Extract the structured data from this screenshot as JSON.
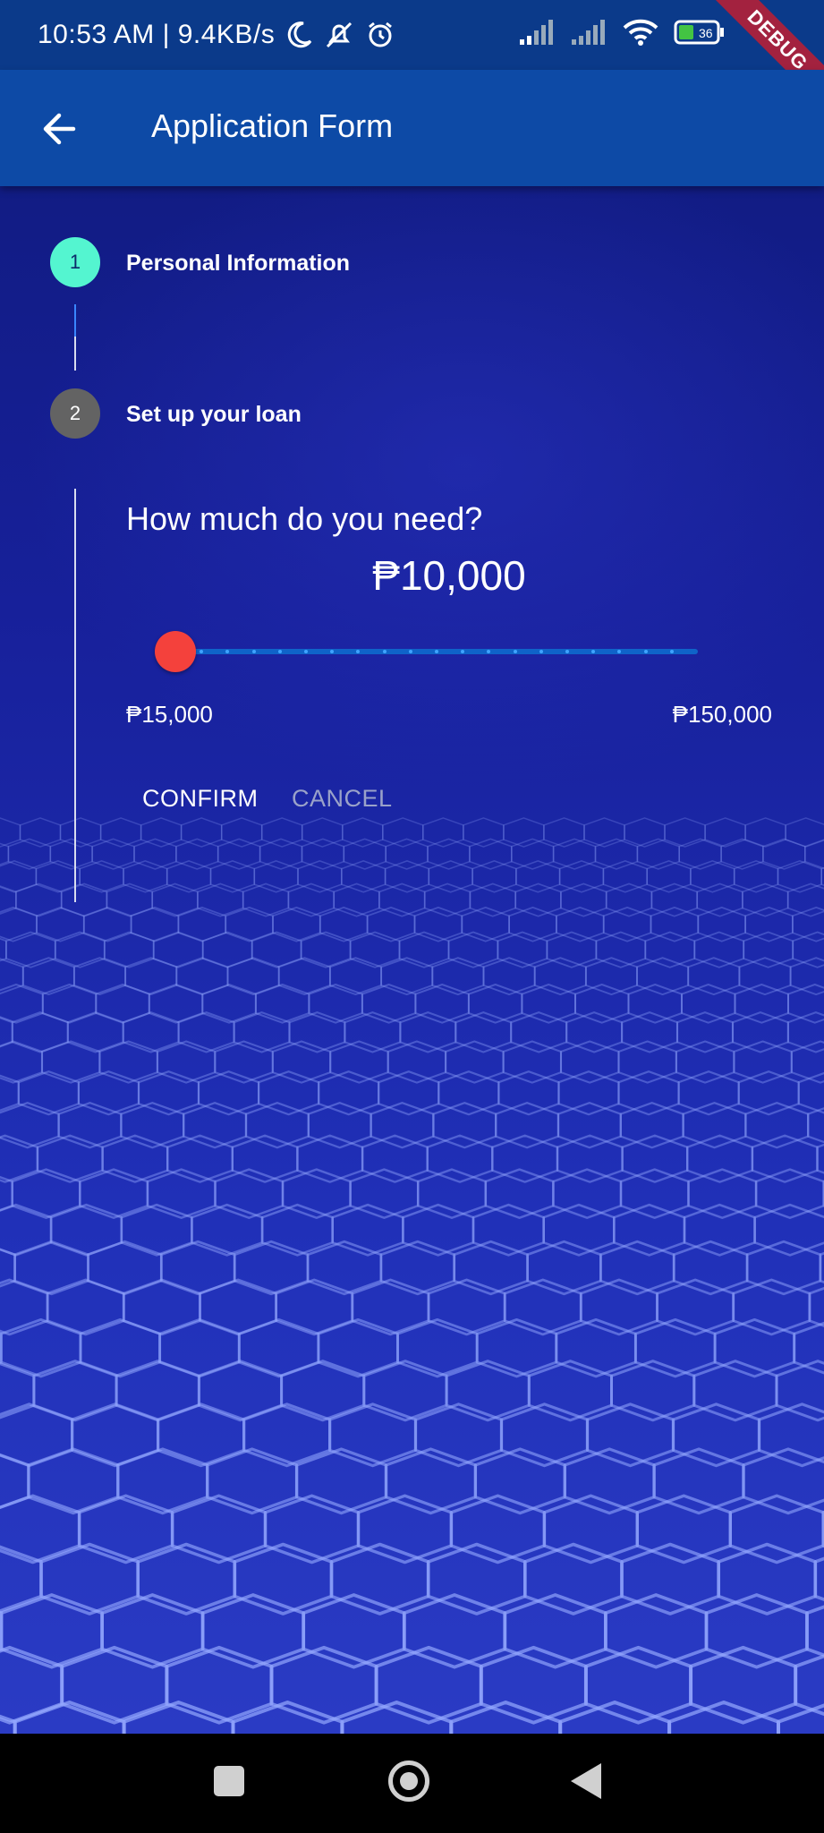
{
  "status_bar": {
    "time_speed": "10:53 AM | 9.4KB/s",
    "battery_level": "36",
    "debug_banner": "DEBUG"
  },
  "app_bar": {
    "title": "Application Form"
  },
  "stepper": {
    "steps": [
      {
        "number": "1",
        "title": "Personal Information"
      },
      {
        "number": "2",
        "title": "Set up your loan"
      }
    ],
    "active_step": {
      "question": "How much do you need?",
      "amount": "₱10,000",
      "slider": {
        "value_fraction": 0,
        "min_label": "₱15,000",
        "max_label": "₱150,000"
      },
      "confirm_label": "CONFIRM",
      "cancel_label": "CANCEL"
    }
  },
  "colors": {
    "appbar": "#0d4aa6",
    "step_active": "#54f5d0",
    "step_inactive": "#636363",
    "slider_thumb": "#f4413c",
    "slider_track": "#0f63c9"
  }
}
